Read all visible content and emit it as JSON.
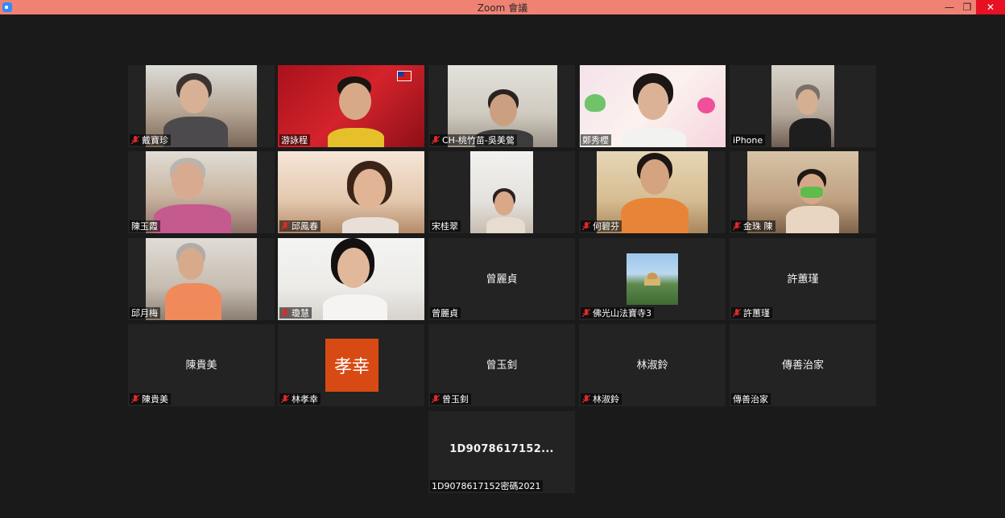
{
  "window": {
    "title": "Zoom 會議",
    "minimize": "—",
    "maximize": "❐",
    "close": "✕"
  },
  "tiles": [
    {
      "name": "戴寶珍",
      "muted": true,
      "video": true
    },
    {
      "name": "游詠程",
      "muted": false,
      "video": true,
      "active": true
    },
    {
      "name": "CH-桃竹苗-吳美鶯",
      "muted": true,
      "video": true
    },
    {
      "name": "鄭秀櫻",
      "muted": false,
      "video": true
    },
    {
      "name": "iPhone",
      "muted": false,
      "video": true
    },
    {
      "name": "陳玉霞",
      "muted": false,
      "video": true
    },
    {
      "name": "邱鳳春",
      "muted": true,
      "video": true
    },
    {
      "name": "宋桂翠",
      "muted": false,
      "video": true
    },
    {
      "name": "何碧芬",
      "muted": true,
      "video": true
    },
    {
      "name": "金珠 陳",
      "muted": true,
      "video": true
    },
    {
      "name": "邱月梅",
      "muted": false,
      "video": true
    },
    {
      "name": "瓊慧",
      "muted": true,
      "video": true
    },
    {
      "name": "曾麗貞",
      "muted": false,
      "video": false,
      "center": "曾麗貞"
    },
    {
      "name": "佛光山法寶寺3",
      "muted": true,
      "video": false,
      "avatar_image": true
    },
    {
      "name": "許蕙瑾",
      "muted": true,
      "video": false,
      "center": "許蕙瑾"
    },
    {
      "name": "陳貴美",
      "muted": true,
      "video": false,
      "center": "陳貴美"
    },
    {
      "name": "林孝幸",
      "muted": true,
      "video": false,
      "avatar_text": "孝幸",
      "avatar_color": "#d84a14"
    },
    {
      "name": "曾玉釗",
      "muted": true,
      "video": false,
      "center": "曾玉釗"
    },
    {
      "name": "林淑鈴",
      "muted": true,
      "video": false,
      "center": "林淑鈴"
    },
    {
      "name": "傳善治家",
      "muted": false,
      "video": false,
      "center": "傳善治家"
    },
    {
      "name": "1D9078617152密碼2021",
      "muted": false,
      "video": false,
      "center": "1D9078617152..."
    }
  ],
  "colors": {
    "titlebar": "#f08273",
    "background": "#1a1a1a",
    "tile": "#232323",
    "active_outline": "#b8d94a",
    "muted_icon": "#e02828"
  }
}
